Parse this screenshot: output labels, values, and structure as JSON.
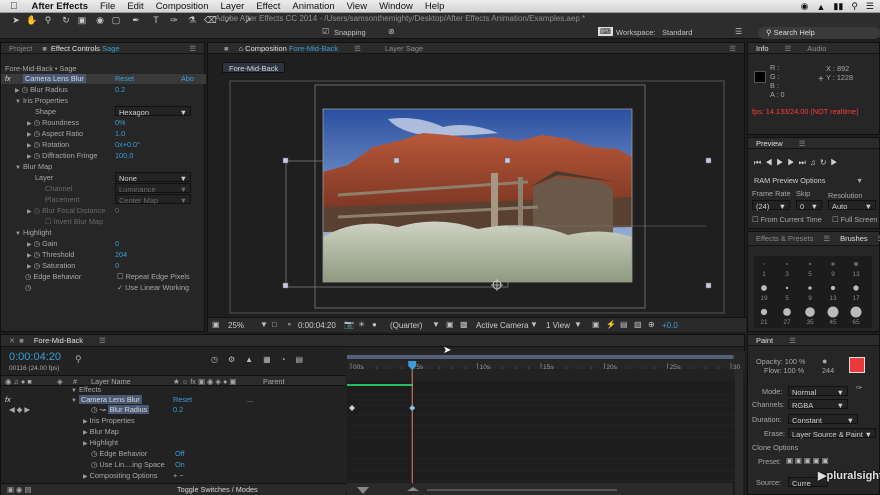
{
  "menubar": {
    "app": "After Effects",
    "items": [
      "File",
      "Edit",
      "Composition",
      "Layer",
      "Effect",
      "Animation",
      "View",
      "Window",
      "Help"
    ]
  },
  "toolbar": {
    "window_title": "Adobe After Effects CC 2014 - /Users/samsonthemighty/Desktop/After Effects Animation/Examples.aep *",
    "snapping": "Snapping",
    "workspace_label": "Workspace:",
    "workspace_value": "Standard",
    "search_placeholder": "Search Help"
  },
  "left_panel": {
    "tabs": {
      "project": "Project",
      "effect_controls": "Effect Controls",
      "ec_layer": "Sage"
    },
    "layer_path": "Fore-Mid-Back • Sage",
    "effect_name": "Camera Lens Blur",
    "reset": "Reset",
    "about": "Abo",
    "blur_radius": {
      "label": "Blur Radius",
      "value": "0.2"
    },
    "iris_properties": "Iris Properties",
    "shape": {
      "label": "Shape",
      "value": "Hexagon"
    },
    "roundness": {
      "label": "Roundness",
      "value": "0%"
    },
    "aspect_ratio": {
      "label": "Aspect Ratio",
      "value": "1.0"
    },
    "rotation": {
      "label": "Rotation",
      "value": "0x+0.0°"
    },
    "diffraction": {
      "label": "Diffraction Fringe",
      "value": "100.0"
    },
    "blur_map": "Blur Map",
    "layer": {
      "label": "Layer",
      "value": "None"
    },
    "channel": {
      "label": "Channel",
      "value": "Luminance"
    },
    "placement": {
      "label": "Placement",
      "value": "Center Map"
    },
    "blur_focal": {
      "label": "Blur Focal Distance",
      "value": "0"
    },
    "invert_blur": "Invert Blur Map",
    "highlight": "Highlight",
    "gain": {
      "label": "Gain",
      "value": "0"
    },
    "threshold": {
      "label": "Threshold",
      "value": "204"
    },
    "saturation": {
      "label": "Saturation",
      "value": "0"
    },
    "edge_behavior": {
      "label": "Edge Behavior",
      "value": "Repeat Edge Pixels"
    },
    "use_linear": "Use Linear Working"
  },
  "comp_panel": {
    "tab_prefix": "Composition",
    "comp_name": "Fore-Mid-Back",
    "layer_tab": "Layer Sage",
    "crumb": "Fore-Mid-Back",
    "zoom": "25%",
    "timecode": "0:00:04:20",
    "resolution": "(Quarter)",
    "camera": "Active Camera",
    "view": "1 View",
    "exposure": "+0.0"
  },
  "info_panel": {
    "tabs": {
      "info": "Info",
      "audio": "Audio"
    },
    "r": "R :",
    "g": "G :",
    "b": "B :",
    "a": "A : 0",
    "x": "X : 892",
    "y": "Y : 1228",
    "fps": "fps: 14.133/24.00 (NOT realtime)"
  },
  "preview_panel": {
    "title": "Preview",
    "ram": "RAM Preview Options",
    "headers": {
      "frame_rate": "Frame Rate",
      "skip": "Skip",
      "resolution": "Resolution"
    },
    "values": {
      "frame_rate": "(24)",
      "skip": "0",
      "resolution": "Auto"
    },
    "from_current": "From Current Time",
    "full_screen": "Full Screen"
  },
  "brushes_panel": {
    "tabs": {
      "effects": "Effects & Presets",
      "brushes": "Brushes"
    },
    "sizes": [
      "1",
      "3",
      "5",
      "9",
      "13",
      "19",
      "5",
      "9",
      "13",
      "17",
      "21",
      "27",
      "35",
      "45",
      "65"
    ]
  },
  "timeline": {
    "tab": "Fore-Mid-Back",
    "timecode": "0:00:04:20",
    "fps_line": "00116 (24.00 fps)",
    "layer_name_header": "Layer Name",
    "parent_header": "Parent",
    "ticks": [
      "00s",
      "5s",
      "10s",
      "15s",
      "20s",
      "25s",
      "30"
    ],
    "rows": {
      "effects": "Effects",
      "effect": "Camera Lens Blur",
      "reset": "Reset",
      "dots": "...",
      "blur_radius": "Blur Radius",
      "blur_value": "0.2",
      "iris": "Iris Properties",
      "blur_map": "Blur Map",
      "highlight": "Highlight",
      "edge": "Edge Behavior",
      "edge_value": "Off",
      "use_lin": "Use Lin....ing Space",
      "use_lin_value": "On",
      "compositing": "Compositing Options",
      "plus": "+ −"
    },
    "toggle": "Toggle Switches / Modes"
  },
  "paint_panel": {
    "title": "Paint",
    "opacity": "Opacity: 100 %",
    "flow": "Flow: 100 %",
    "brush_size": "244",
    "mode_label": "Mode:",
    "mode_value": "Normal",
    "channels_label": "Channels:",
    "channels_value": "RGBA",
    "duration_label": "Duration:",
    "duration_value": "Constant",
    "erase_label": "Erase:",
    "erase_value": "Layer Source & Paint",
    "clone_options": "Clone Options",
    "preset_label": "Preset:",
    "source_label": "Source:",
    "source_value": "Curre"
  },
  "watermark": "pluralsight",
  "colors": {
    "accent_blue": "#3b9dd9",
    "fps_red": "#ff3b3b",
    "swatch_red": "#e83a3a",
    "timeline_green": "#22c05a",
    "playhead": "#3b9dd9"
  }
}
